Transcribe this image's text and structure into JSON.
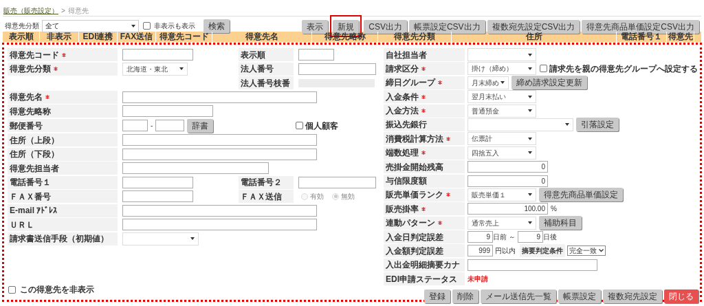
{
  "breadcrumb": {
    "parent": "販売（販売設定）",
    "separator": ">",
    "current": "得意先"
  },
  "filter": {
    "label": "得意先分類",
    "value": "全て",
    "show_hidden": {
      "label": "非表示も表示",
      "checked": false
    },
    "search_button": "検索"
  },
  "toolbar": [
    {
      "label": "表示",
      "highlighted": false
    },
    {
      "label": "新規",
      "highlighted": true
    },
    {
      "label": "CSV出力",
      "highlighted": false
    },
    {
      "label": "帳票設定CSV出力",
      "highlighted": false
    },
    {
      "label": "複数宛先設定CSV出力",
      "highlighted": false
    },
    {
      "label": "得意先商品単価設定CSV出力",
      "highlighted": false
    }
  ],
  "table": {
    "columns": [
      "表示順",
      "非表示",
      "EDI連携",
      "FAX送信",
      "得意先コード",
      "得意先名",
      "得意先略称",
      "得意先分類",
      "住所",
      "電話番号１",
      "得意先"
    ]
  },
  "form": {
    "left": [
      {
        "label": "得意先コード",
        "required": true,
        "field": {
          "kind": "short-input"
        },
        "secondary": {
          "label": "表示順",
          "field": {
            "kind": "tiny-input"
          }
        }
      },
      {
        "label": "得意先分類",
        "required": true,
        "field": {
          "kind": "select",
          "value": "北海道・東北"
        },
        "secondary": {
          "label": "法人番号",
          "field": {
            "kind": "medium-input"
          }
        }
      },
      {
        "secondary": {
          "label": "法人番号枝番",
          "field": {
            "kind": "readonly"
          }
        }
      },
      {
        "label": "得意先名",
        "required": true,
        "field": {
          "kind": "long-input"
        }
      },
      {
        "label": "得意先略称",
        "required": false,
        "field": {
          "kind": "mid-input"
        }
      },
      {
        "label": "郵便番号",
        "required": false,
        "field": {
          "kind": "postal",
          "separator": "-",
          "button": "辞書",
          "checkbox": {
            "label": "個人顧客",
            "checked": false
          }
        }
      },
      {
        "label": "住所（上段）",
        "required": false,
        "field": {
          "kind": "long-input"
        }
      },
      {
        "label": "住所（下段）",
        "required": false,
        "field": {
          "kind": "long-input"
        }
      },
      {
        "label": "得意先担当者",
        "required": false,
        "field": {
          "kind": "wide-input"
        }
      },
      {
        "label": "電話番号１",
        "required": false,
        "field": {
          "kind": "short-input"
        },
        "secondary": {
          "label": "電話番号２",
          "field": {
            "kind": "medium-input"
          }
        }
      },
      {
        "label": "ＦＡＸ番号",
        "required": false,
        "field": {
          "kind": "short-input"
        },
        "secondary": {
          "label": "ＦＡＸ送信",
          "field": {
            "kind": "radio",
            "disabled": true,
            "options": [
              {
                "label": "有効",
                "selected": false
              },
              {
                "label": "無効",
                "selected": true
              }
            ]
          }
        }
      },
      {
        "label": "E-mail ｱﾄﾞﾚｽ",
        "required": false,
        "field": {
          "kind": "long-input"
        }
      },
      {
        "label": "ＵＲＬ",
        "required": false,
        "field": {
          "kind": "long-input"
        }
      },
      {
        "label": "請求書送信手段（初期値）",
        "required": false,
        "field": {
          "kind": "select-wide"
        }
      }
    ],
    "hide_checkbox": {
      "label": "この得意先を非表示",
      "checked": false
    },
    "right": [
      {
        "label": "自社担当者",
        "required": false,
        "kind": "select"
      },
      {
        "label": "請求区分",
        "required": true,
        "kind": "select",
        "value": "掛け（締め）",
        "checkbox": {
          "label": "請求先を親の得意先グループへ設定する",
          "checked": false
        }
      },
      {
        "label": "締日グループ",
        "required": true,
        "kind": "select-small",
        "value": "月末締め",
        "button": "締め請求設定更新"
      },
      {
        "label": "入金条件",
        "required": true,
        "kind": "select",
        "value": "翌月末払い"
      },
      {
        "label": "入金方法",
        "required": true,
        "kind": "select",
        "value": "普通預金"
      },
      {
        "label": "振込先銀行",
        "required": false,
        "kind": "select-wide",
        "button": "引落設定"
      },
      {
        "label": "消費税計算方法",
        "required": true,
        "kind": "select",
        "value": "伝票計"
      },
      {
        "label": "端数処理",
        "required": true,
        "kind": "select",
        "value": "四捨五入"
      },
      {
        "label": "売掛金開始残高",
        "required": false,
        "kind": "number",
        "value": "0"
      },
      {
        "label": "与信限度額",
        "required": false,
        "kind": "number",
        "value": "0"
      },
      {
        "label": "販売単価ランク",
        "required": true,
        "kind": "select",
        "value": "販売単価１",
        "button": "得意先商品単価設定"
      },
      {
        "label": "販売掛率",
        "required": true,
        "kind": "number",
        "value": "100.00",
        "suffix": "%"
      },
      {
        "label": "連動パターン",
        "required": true,
        "kind": "select",
        "value": "通常売上",
        "button": "補助科目"
      },
      {
        "label": "入金日判定誤差",
        "required": false,
        "kind": "range",
        "from": "9",
        "from_suffix": "日前",
        "separator": "～",
        "to": "9",
        "to_suffix": "日後"
      },
      {
        "label": "入金額判定誤差",
        "required": false,
        "kind": "amount",
        "value": "999",
        "suffix": "円以内",
        "sublabel": "摘要判定条件",
        "option": "完全一致"
      },
      {
        "label": "入出金明細摘要カナ",
        "required": false,
        "kind": "text"
      },
      {
        "label": "EDI申請ステータス",
        "required": false,
        "kind": "status",
        "value": "未申請"
      }
    ],
    "buttons": [
      {
        "label": "登録",
        "kind": "normal"
      },
      {
        "label": "削除",
        "kind": "normal"
      },
      {
        "label": "メール送信先一覧",
        "kind": "normal"
      },
      {
        "label": "帳票設定",
        "kind": "normal"
      },
      {
        "label": "複数宛先設定",
        "kind": "normal"
      },
      {
        "label": "閉じる",
        "kind": "danger"
      }
    ]
  }
}
